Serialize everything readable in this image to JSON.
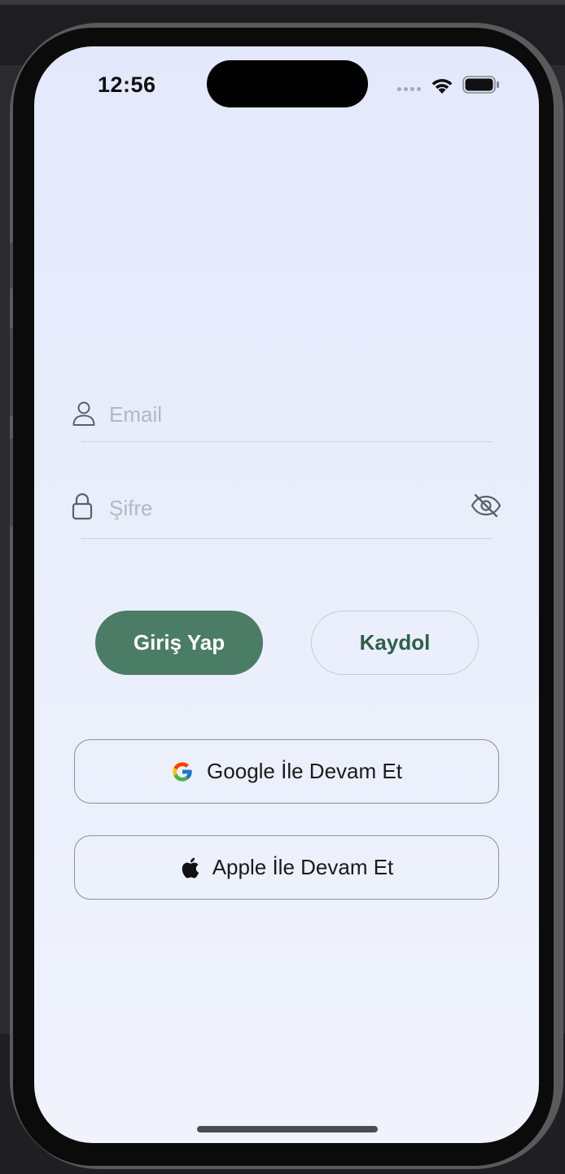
{
  "status_bar": {
    "time": "12:56",
    "icons": [
      "signal-dots-icon",
      "wifi-icon",
      "battery-icon"
    ]
  },
  "form": {
    "email": {
      "placeholder": "Email",
      "value": "",
      "icon": "user-icon"
    },
    "password": {
      "placeholder": "Şifre",
      "value": "",
      "icon": "lock-icon",
      "toggle_icon": "eye-slash-icon"
    }
  },
  "actions": {
    "login_label": "Giriş Yap",
    "register_label": "Kaydol"
  },
  "social": {
    "google_label": "Google İle Devam Et",
    "apple_label": "Apple İle Devam Et"
  },
  "colors": {
    "primary_green": "#4b7c65",
    "register_text": "#2f5e46",
    "background_top": "#e3e9fb",
    "background_bottom": "#f0f3fc"
  }
}
